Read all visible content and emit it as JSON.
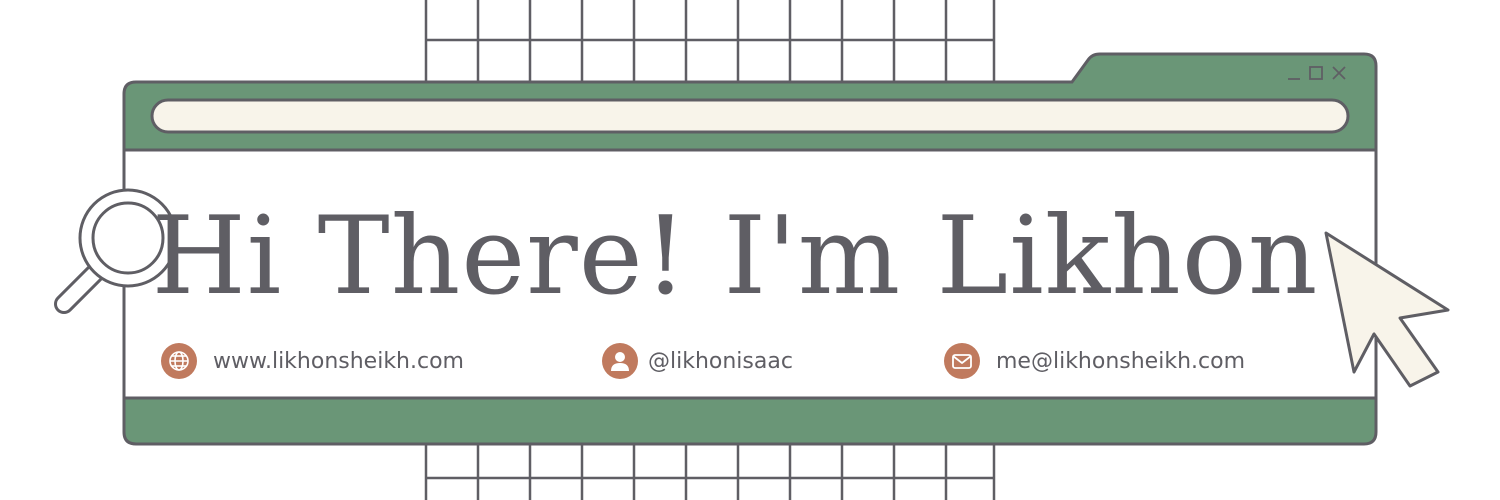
{
  "headline": "Hi There! I'm Likhon",
  "contacts": [
    {
      "icon": "globe-icon",
      "text": "www.likhonsheikh.com"
    },
    {
      "icon": "user-icon",
      "text": "@likhonisaac"
    },
    {
      "icon": "mail-icon",
      "text": "me@likhonsheikh.com"
    }
  ],
  "colors": {
    "frame_green": "#6a9677",
    "outline": "#5f5e64",
    "cream": "#f8f4ea",
    "icon_accent": "#c07a5e",
    "text": "#5f5e64"
  },
  "window_controls": [
    "minimize-icon",
    "maximize-icon",
    "close-icon"
  ]
}
